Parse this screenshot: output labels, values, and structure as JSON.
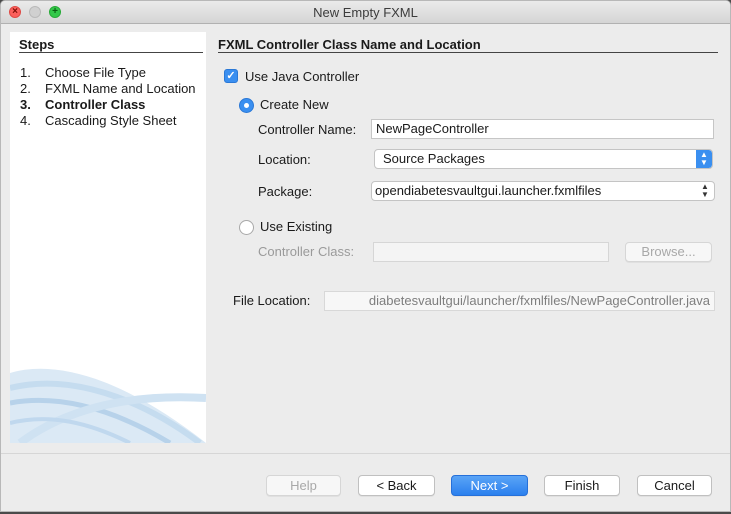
{
  "window": {
    "title": "New Empty FXML"
  },
  "steps": {
    "title": "Steps",
    "items": [
      {
        "num": "1.",
        "label": "Choose File Type",
        "current": false
      },
      {
        "num": "2.",
        "label": "FXML Name and Location",
        "current": false
      },
      {
        "num": "3.",
        "label": "Controller Class",
        "current": true
      },
      {
        "num": "4.",
        "label": "Cascading Style Sheet",
        "current": false
      }
    ]
  },
  "panel": {
    "title": "FXML Controller Class Name and Location",
    "use_java_controller": {
      "label": "Use Java Controller",
      "checked": true
    },
    "create_new": {
      "label": "Create New",
      "selected": true
    },
    "controller_name": {
      "label": "Controller Name:",
      "value": "NewPageController"
    },
    "location": {
      "label": "Location:",
      "value": "Source Packages"
    },
    "package": {
      "label": "Package:",
      "value": "opendiabetesvaultgui.launcher.fxmlfiles"
    },
    "use_existing": {
      "label": "Use Existing",
      "selected": false
    },
    "controller_class": {
      "label": "Controller Class:",
      "value": ""
    },
    "browse_label": "Browse...",
    "file_location": {
      "label": "File Location:",
      "value": "diabetesvaultgui/launcher/fxmlfiles/NewPageController.java"
    }
  },
  "buttons": {
    "help": "Help",
    "back": "< Back",
    "next": "Next >",
    "finish": "Finish",
    "cancel": "Cancel"
  },
  "colors": {
    "accent": "#3a8ff0",
    "window_bg": "#ececec"
  }
}
